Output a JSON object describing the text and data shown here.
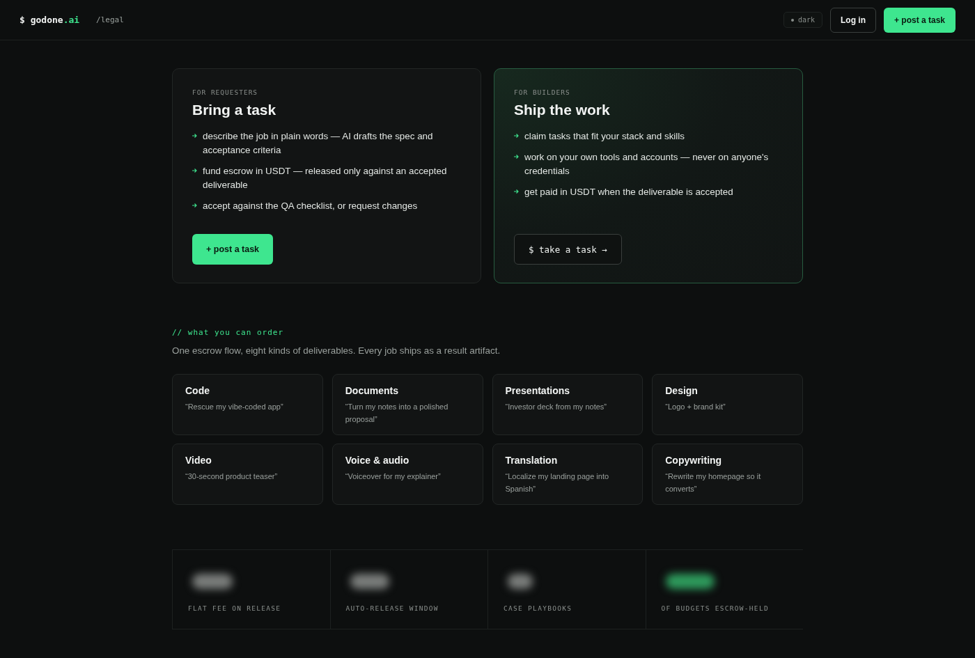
{
  "header": {
    "logo_prefix": "$ ",
    "logo_name": "godone",
    "logo_tld": ".ai",
    "path": "/legal",
    "theme_toggle": "dark",
    "login": "Log in",
    "post_button": "+ post a task"
  },
  "audiences": [
    {
      "eyebrow": "FOR REQUESTERS",
      "title": "Bring a task",
      "highlighted": false,
      "bullets": [
        "describe the job in plain words — AI drafts the spec and acceptance criteria",
        "fund escrow in USDT — released only against an accepted deliverable",
        "accept against the QA checklist, or request changes"
      ],
      "button": {
        "kind": "primary",
        "label": "+ post a task"
      }
    },
    {
      "eyebrow": "FOR BUILDERS",
      "title": "Ship the work",
      "highlighted": true,
      "bullets": [
        "claim tasks that fit your stack and skills",
        "work on your own tools and accounts — never on anyone's credentials",
        "get paid in USDT when the deliverable is accepted"
      ],
      "button": {
        "kind": "terminal",
        "label": "$ take a task →"
      }
    }
  ],
  "order_section": {
    "label": "// what you can order",
    "subtitle": "One escrow flow, eight kinds of deliverables. Every job ships as a result artifact.",
    "kinds": [
      {
        "title": "Code",
        "example": "“Rescue my vibe-coded app”"
      },
      {
        "title": "Documents",
        "example": "“Turn my notes into a polished proposal”"
      },
      {
        "title": "Presentations",
        "example": "“Investor deck from my notes”"
      },
      {
        "title": "Design",
        "example": "“Logo + brand kit”"
      },
      {
        "title": "Video",
        "example": "“30-second product teaser”"
      },
      {
        "title": "Voice & audio",
        "example": "“Voiceover for my explainer”"
      },
      {
        "title": "Translation",
        "example": "“Localize my landing page into Spanish”"
      },
      {
        "title": "Copywriting",
        "example": "“Rewrite my homepage so it converts”"
      }
    ]
  },
  "stats": [
    {
      "label": "FLAT FEE ON RELEASE",
      "accent": false
    },
    {
      "label": "AUTO-RELEASE WINDOW",
      "accent": false
    },
    {
      "label": "CASE PLAYBOOKS",
      "accent": false
    },
    {
      "label": "OF BUDGETS ESCROW-HELD",
      "accent": true
    }
  ]
}
